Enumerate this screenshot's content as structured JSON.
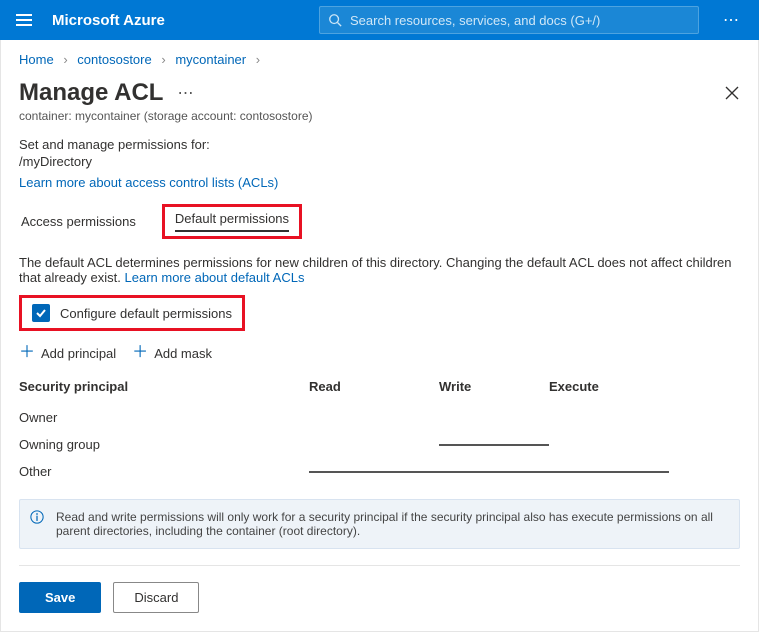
{
  "topbar": {
    "brand": "Microsoft Azure",
    "search_placeholder": "Search resources, services, and docs (G+/)"
  },
  "breadcrumb": {
    "items": [
      "Home",
      "contosostore",
      "mycontainer"
    ]
  },
  "page": {
    "title": "Manage ACL",
    "subtitle": "container: mycontainer (storage account: contosostore)",
    "intro": "Set and manage permissions for:",
    "path": "/myDirectory",
    "learn_acl": "Learn more about access control lists (ACLs)"
  },
  "tabs": {
    "access": "Access permissions",
    "default": "Default permissions"
  },
  "default_section": {
    "desc_prefix": "The default ACL determines permissions for new children of this directory. Changing the default ACL does not affect children that already exist. ",
    "learn_link": "Learn more about default ACLs",
    "configure_label": "Configure default permissions"
  },
  "actions": {
    "add_principal": "Add principal",
    "add_mask": "Add mask"
  },
  "table": {
    "headers": {
      "principal": "Security principal",
      "read": "Read",
      "write": "Write",
      "execute": "Execute"
    },
    "rows": [
      {
        "name": "Owner",
        "read": true,
        "write": true,
        "execute": true
      },
      {
        "name": "Owning group",
        "read": true,
        "write": false,
        "execute": true
      },
      {
        "name": "Other",
        "read": false,
        "write": false,
        "execute": false
      }
    ]
  },
  "info": {
    "text": "Read and write permissions will only work for a security principal if the security principal also has execute permissions on all parent directories, including the container (root directory)."
  },
  "buttons": {
    "save": "Save",
    "discard": "Discard"
  }
}
